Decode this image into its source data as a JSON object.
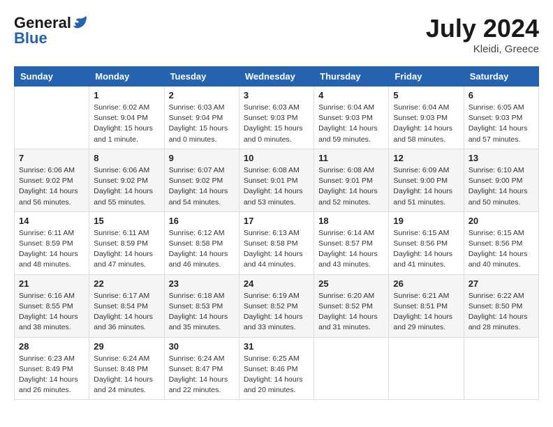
{
  "header": {
    "logo_general": "General",
    "logo_blue": "Blue",
    "month_year": "July 2024",
    "location": "Kleidi, Greece"
  },
  "days_of_week": [
    "Sunday",
    "Monday",
    "Tuesday",
    "Wednesday",
    "Thursday",
    "Friday",
    "Saturday"
  ],
  "weeks": [
    [
      {
        "day": "",
        "sunrise": "",
        "sunset": "",
        "daylight": ""
      },
      {
        "day": "1",
        "sunrise": "Sunrise: 6:02 AM",
        "sunset": "Sunset: 9:04 PM",
        "daylight": "Daylight: 15 hours and 1 minute."
      },
      {
        "day": "2",
        "sunrise": "Sunrise: 6:03 AM",
        "sunset": "Sunset: 9:04 PM",
        "daylight": "Daylight: 15 hours and 0 minutes."
      },
      {
        "day": "3",
        "sunrise": "Sunrise: 6:03 AM",
        "sunset": "Sunset: 9:03 PM",
        "daylight": "Daylight: 15 hours and 0 minutes."
      },
      {
        "day": "4",
        "sunrise": "Sunrise: 6:04 AM",
        "sunset": "Sunset: 9:03 PM",
        "daylight": "Daylight: 14 hours and 59 minutes."
      },
      {
        "day": "5",
        "sunrise": "Sunrise: 6:04 AM",
        "sunset": "Sunset: 9:03 PM",
        "daylight": "Daylight: 14 hours and 58 minutes."
      },
      {
        "day": "6",
        "sunrise": "Sunrise: 6:05 AM",
        "sunset": "Sunset: 9:03 PM",
        "daylight": "Daylight: 14 hours and 57 minutes."
      }
    ],
    [
      {
        "day": "7",
        "sunrise": "Sunrise: 6:06 AM",
        "sunset": "Sunset: 9:02 PM",
        "daylight": "Daylight: 14 hours and 56 minutes."
      },
      {
        "day": "8",
        "sunrise": "Sunrise: 6:06 AM",
        "sunset": "Sunset: 9:02 PM",
        "daylight": "Daylight: 14 hours and 55 minutes."
      },
      {
        "day": "9",
        "sunrise": "Sunrise: 6:07 AM",
        "sunset": "Sunset: 9:02 PM",
        "daylight": "Daylight: 14 hours and 54 minutes."
      },
      {
        "day": "10",
        "sunrise": "Sunrise: 6:08 AM",
        "sunset": "Sunset: 9:01 PM",
        "daylight": "Daylight: 14 hours and 53 minutes."
      },
      {
        "day": "11",
        "sunrise": "Sunrise: 6:08 AM",
        "sunset": "Sunset: 9:01 PM",
        "daylight": "Daylight: 14 hours and 52 minutes."
      },
      {
        "day": "12",
        "sunrise": "Sunrise: 6:09 AM",
        "sunset": "Sunset: 9:00 PM",
        "daylight": "Daylight: 14 hours and 51 minutes."
      },
      {
        "day": "13",
        "sunrise": "Sunrise: 6:10 AM",
        "sunset": "Sunset: 9:00 PM",
        "daylight": "Daylight: 14 hours and 50 minutes."
      }
    ],
    [
      {
        "day": "14",
        "sunrise": "Sunrise: 6:11 AM",
        "sunset": "Sunset: 8:59 PM",
        "daylight": "Daylight: 14 hours and 48 minutes."
      },
      {
        "day": "15",
        "sunrise": "Sunrise: 6:11 AM",
        "sunset": "Sunset: 8:59 PM",
        "daylight": "Daylight: 14 hours and 47 minutes."
      },
      {
        "day": "16",
        "sunrise": "Sunrise: 6:12 AM",
        "sunset": "Sunset: 8:58 PM",
        "daylight": "Daylight: 14 hours and 46 minutes."
      },
      {
        "day": "17",
        "sunrise": "Sunrise: 6:13 AM",
        "sunset": "Sunset: 8:58 PM",
        "daylight": "Daylight: 14 hours and 44 minutes."
      },
      {
        "day": "18",
        "sunrise": "Sunrise: 6:14 AM",
        "sunset": "Sunset: 8:57 PM",
        "daylight": "Daylight: 14 hours and 43 minutes."
      },
      {
        "day": "19",
        "sunrise": "Sunrise: 6:15 AM",
        "sunset": "Sunset: 8:56 PM",
        "daylight": "Daylight: 14 hours and 41 minutes."
      },
      {
        "day": "20",
        "sunrise": "Sunrise: 6:15 AM",
        "sunset": "Sunset: 8:56 PM",
        "daylight": "Daylight: 14 hours and 40 minutes."
      }
    ],
    [
      {
        "day": "21",
        "sunrise": "Sunrise: 6:16 AM",
        "sunset": "Sunset: 8:55 PM",
        "daylight": "Daylight: 14 hours and 38 minutes."
      },
      {
        "day": "22",
        "sunrise": "Sunrise: 6:17 AM",
        "sunset": "Sunset: 8:54 PM",
        "daylight": "Daylight: 14 hours and 36 minutes."
      },
      {
        "day": "23",
        "sunrise": "Sunrise: 6:18 AM",
        "sunset": "Sunset: 8:53 PM",
        "daylight": "Daylight: 14 hours and 35 minutes."
      },
      {
        "day": "24",
        "sunrise": "Sunrise: 6:19 AM",
        "sunset": "Sunset: 8:52 PM",
        "daylight": "Daylight: 14 hours and 33 minutes."
      },
      {
        "day": "25",
        "sunrise": "Sunrise: 6:20 AM",
        "sunset": "Sunset: 8:52 PM",
        "daylight": "Daylight: 14 hours and 31 minutes."
      },
      {
        "day": "26",
        "sunrise": "Sunrise: 6:21 AM",
        "sunset": "Sunset: 8:51 PM",
        "daylight": "Daylight: 14 hours and 29 minutes."
      },
      {
        "day": "27",
        "sunrise": "Sunrise: 6:22 AM",
        "sunset": "Sunset: 8:50 PM",
        "daylight": "Daylight: 14 hours and 28 minutes."
      }
    ],
    [
      {
        "day": "28",
        "sunrise": "Sunrise: 6:23 AM",
        "sunset": "Sunset: 8:49 PM",
        "daylight": "Daylight: 14 hours and 26 minutes."
      },
      {
        "day": "29",
        "sunrise": "Sunrise: 6:24 AM",
        "sunset": "Sunset: 8:48 PM",
        "daylight": "Daylight: 14 hours and 24 minutes."
      },
      {
        "day": "30",
        "sunrise": "Sunrise: 6:24 AM",
        "sunset": "Sunset: 8:47 PM",
        "daylight": "Daylight: 14 hours and 22 minutes."
      },
      {
        "day": "31",
        "sunrise": "Sunrise: 6:25 AM",
        "sunset": "Sunset: 8:46 PM",
        "daylight": "Daylight: 14 hours and 20 minutes."
      },
      {
        "day": "",
        "sunrise": "",
        "sunset": "",
        "daylight": ""
      },
      {
        "day": "",
        "sunrise": "",
        "sunset": "",
        "daylight": ""
      },
      {
        "day": "",
        "sunrise": "",
        "sunset": "",
        "daylight": ""
      }
    ]
  ]
}
